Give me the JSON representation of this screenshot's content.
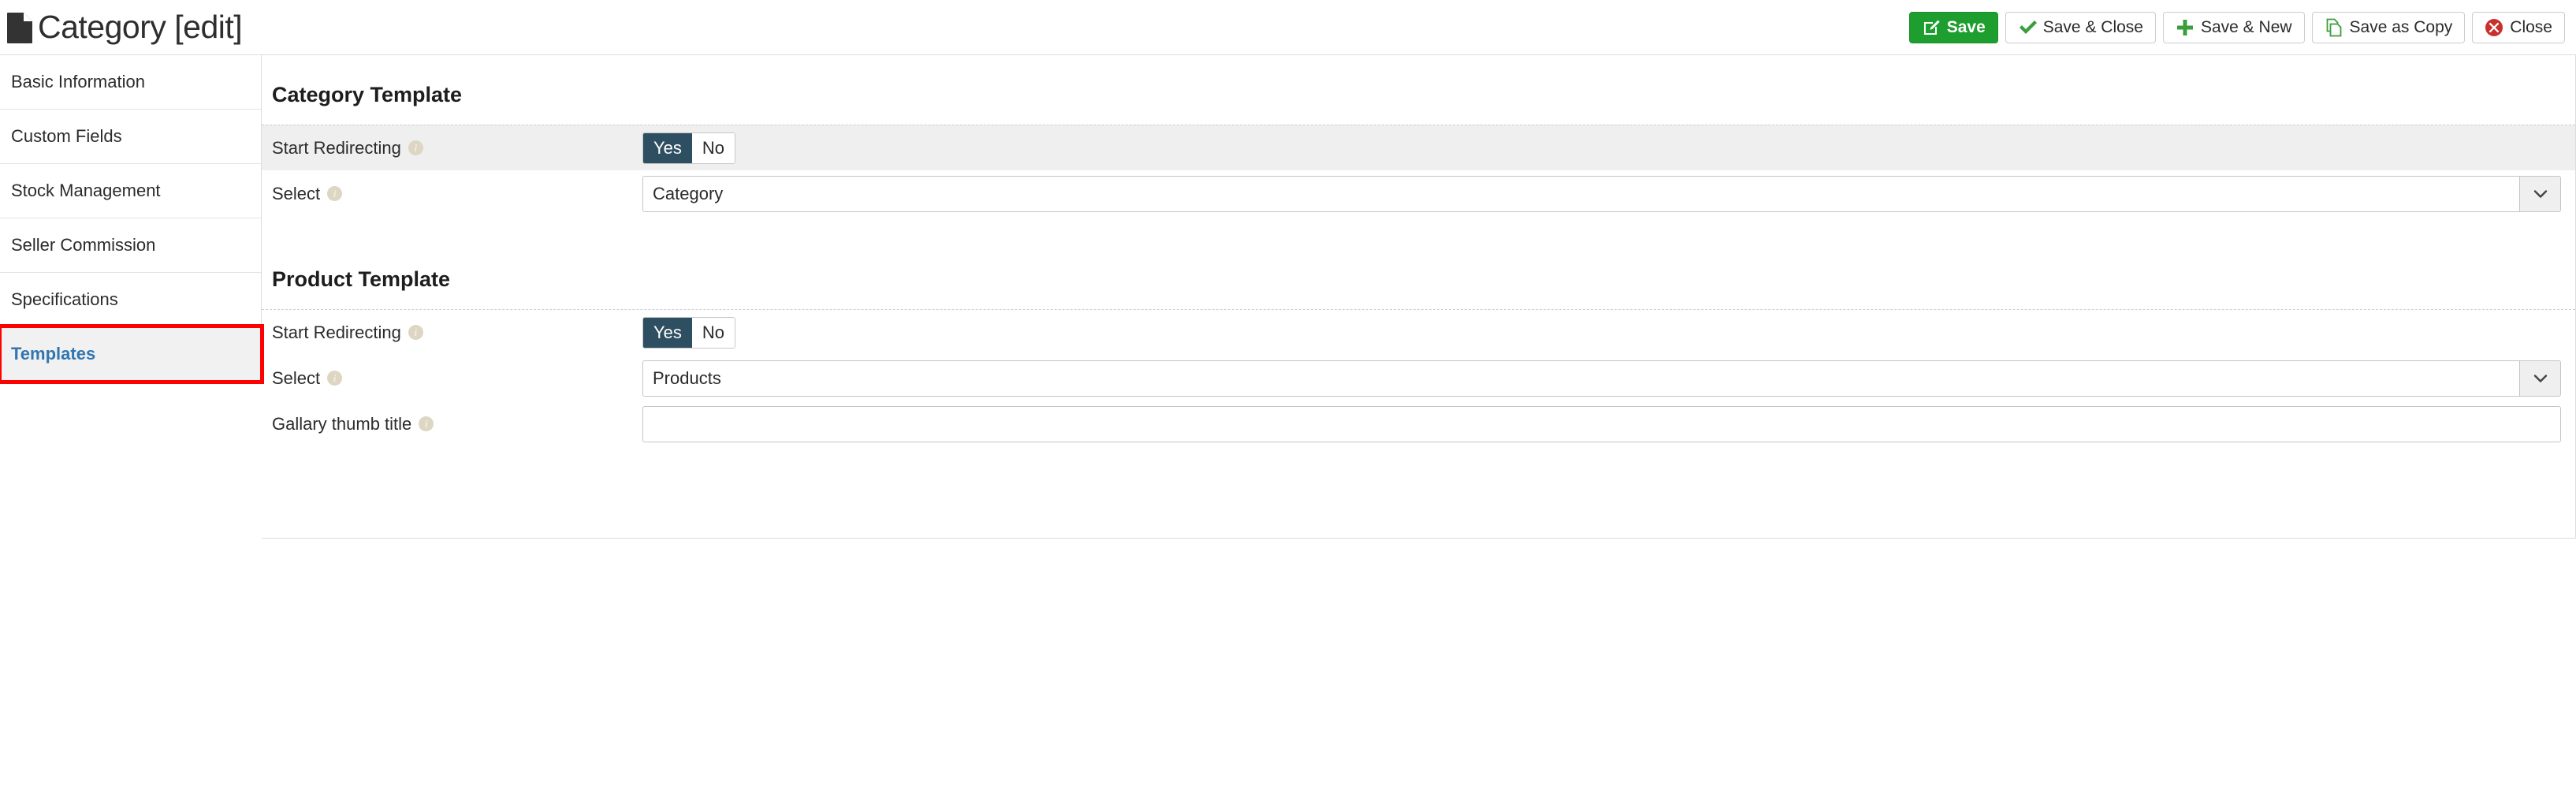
{
  "header": {
    "icon": "document-icon",
    "title": "Category [edit]",
    "toolbar": [
      {
        "label": "Save",
        "icon": "edit-square-icon",
        "style": "primary"
      },
      {
        "label": "Save & Close",
        "icon": "check-icon",
        "style": "default"
      },
      {
        "label": "Save & New",
        "icon": "plus-icon",
        "style": "default"
      },
      {
        "label": "Save as Copy",
        "icon": "copy-icon",
        "style": "default"
      },
      {
        "label": "Close",
        "icon": "close-circle-icon",
        "style": "default"
      }
    ]
  },
  "sidebar": {
    "items": [
      {
        "label": "Basic Information",
        "active": false
      },
      {
        "label": "Custom Fields",
        "active": false
      },
      {
        "label": "Stock Management",
        "active": false
      },
      {
        "label": "Seller Commission",
        "active": false
      },
      {
        "label": "Specifications",
        "active": false
      },
      {
        "label": "Templates",
        "active": true
      }
    ]
  },
  "main": {
    "sections": [
      {
        "title": "Category Template",
        "fields": [
          {
            "label": "Start Redirecting",
            "type": "toggle",
            "options": [
              "Yes",
              "No"
            ],
            "value": "Yes"
          },
          {
            "label": "Select",
            "type": "select",
            "value": "Category"
          }
        ]
      },
      {
        "title": "Product Template",
        "fields": [
          {
            "label": "Start Redirecting",
            "type": "toggle",
            "options": [
              "Yes",
              "No"
            ],
            "value": "Yes"
          },
          {
            "label": "Select",
            "type": "select",
            "value": "Products"
          },
          {
            "label": "Gallary thumb title",
            "type": "text",
            "value": "",
            "placeholder": ""
          }
        ]
      }
    ]
  },
  "colors": {
    "primary_green": "#1e9e2e",
    "toggle_active": "#2e4f61",
    "active_link": "#3276b1",
    "close_red": "#c9302c",
    "annotation_red": "#ff0000",
    "info_icon": "#ddd6c3",
    "row_shade": "#efefef"
  }
}
